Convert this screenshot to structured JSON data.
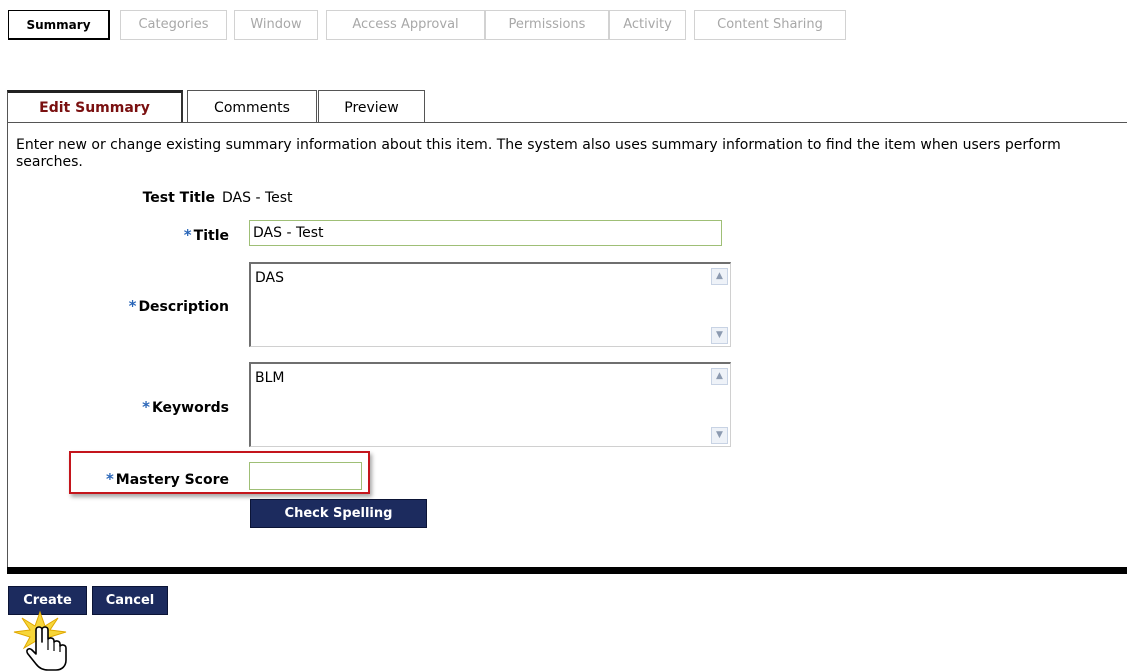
{
  "top_tabs": [
    {
      "label": "Summary",
      "active": true
    },
    {
      "label": "Categories",
      "active": false
    },
    {
      "label": "Window",
      "active": false
    },
    {
      "label": "Access Approval",
      "active": false
    },
    {
      "label": "Permissions",
      "active": false
    },
    {
      "label": "Activity",
      "active": false
    },
    {
      "label": "Content Sharing",
      "active": false
    }
  ],
  "sub_tabs": [
    {
      "label": "Edit Summary",
      "active": true
    },
    {
      "label": "Comments",
      "active": false
    },
    {
      "label": "Preview",
      "active": false
    }
  ],
  "intro_text": "Enter new or change existing summary information about this item. The system also uses summary information to find the item when users perform searches.",
  "form": {
    "test_title_label": "Test Title",
    "test_title_value": "DAS - Test",
    "title_label": "Title",
    "title_value": "DAS - Test",
    "description_label": "Description",
    "description_value": "DAS",
    "keywords_label": "Keywords",
    "keywords_value": "BLM",
    "mastery_label": "Mastery Score",
    "mastery_value": "",
    "required_marker": "*",
    "check_spelling_label": "Check Spelling"
  },
  "footer": {
    "create_label": "Create",
    "cancel_label": "Cancel"
  },
  "colors": {
    "navy_button": "#1c2b5e",
    "active_subtab_text": "#7a1010",
    "required_star": "#2a66b8",
    "highlight_box": "#c4151c",
    "input_border": "#9fbf76"
  },
  "icons": {
    "scroll_up": "triangle-up",
    "scroll_down": "triangle-down",
    "cursor": "pointing-hand-click"
  }
}
